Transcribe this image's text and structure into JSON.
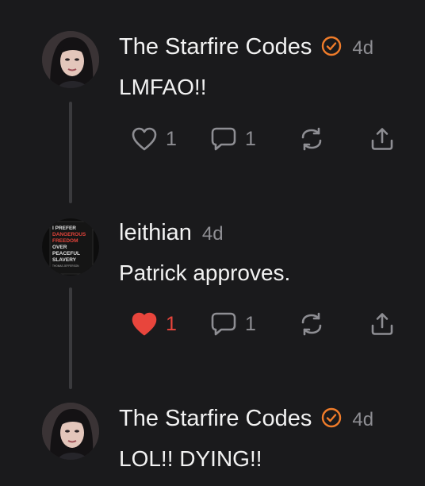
{
  "colors": {
    "background": "#1a1a1c",
    "accent": "#f07c2a",
    "like_active": "#e8453c",
    "muted": "#8e8e93",
    "text": "#f2f2f2"
  },
  "posts": [
    {
      "author": "The Starfire Codes",
      "verified": true,
      "time": "4d",
      "text": "LMFAO!!",
      "avatar_icon": "portrait-avatar",
      "likes": "1",
      "liked": false,
      "replies": "1"
    },
    {
      "author": "leithian",
      "verified": false,
      "time": "4d",
      "text": "Patrick approves.",
      "avatar_icon": "quote-book-avatar",
      "avatar_lines": [
        "I PREFER",
        "DANGEROUS",
        "FREEDOM",
        "OVER",
        "PEACEFUL",
        "SLAVERY",
        "THOMAS JEFFERSON"
      ],
      "likes": "1",
      "liked": true,
      "replies": "1"
    },
    {
      "author": "The Starfire Codes",
      "verified": true,
      "time": "4d",
      "text": "LOL!! DYING!!",
      "avatar_icon": "portrait-avatar"
    }
  ]
}
